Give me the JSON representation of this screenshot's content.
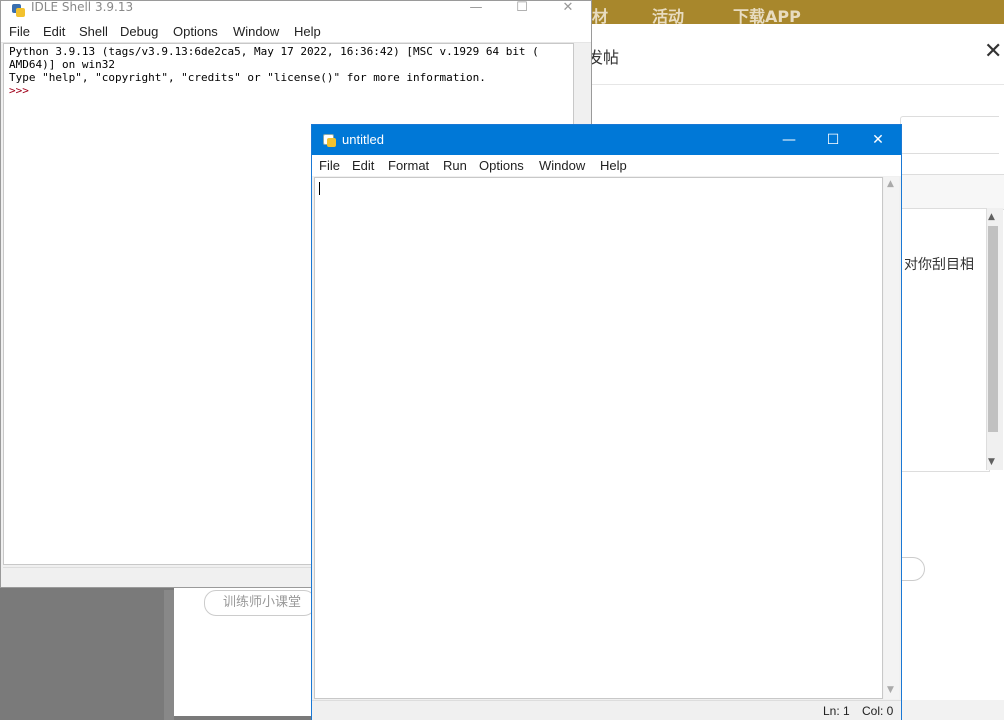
{
  "background_page": {
    "nav_items": [
      "材",
      "活动",
      "下载APP"
    ],
    "post_title": "发帖",
    "close_glyph": "✕",
    "editor_snippet": "对你刮目相",
    "tag_label": "训练师小课堂",
    "colors": {
      "topbar": "#a8872c"
    }
  },
  "shell": {
    "title": "IDLE Shell 3.9.13",
    "menu": [
      "File",
      "Edit",
      "Shell",
      "Debug",
      "Options",
      "Window",
      "Help"
    ],
    "lines": [
      "Python 3.9.13 (tags/v3.9.13:6de2ca5, May 17 2022, 16:36:42) [MSC v.1929 64 bit (",
      "AMD64)] on win32",
      "Type \"help\", \"copyright\", \"credits\" or \"license()\" for more information."
    ],
    "prompt": ">>>",
    "icon": "python-icon"
  },
  "editor": {
    "title": "untitled",
    "menu": [
      "File",
      "Edit",
      "Format",
      "Run",
      "Options",
      "Window",
      "Help"
    ],
    "status": {
      "line": "Ln: 1",
      "col": "Col: 0"
    },
    "icon": "python-file-icon",
    "colors": {
      "titlebar": "#0078d7"
    }
  }
}
